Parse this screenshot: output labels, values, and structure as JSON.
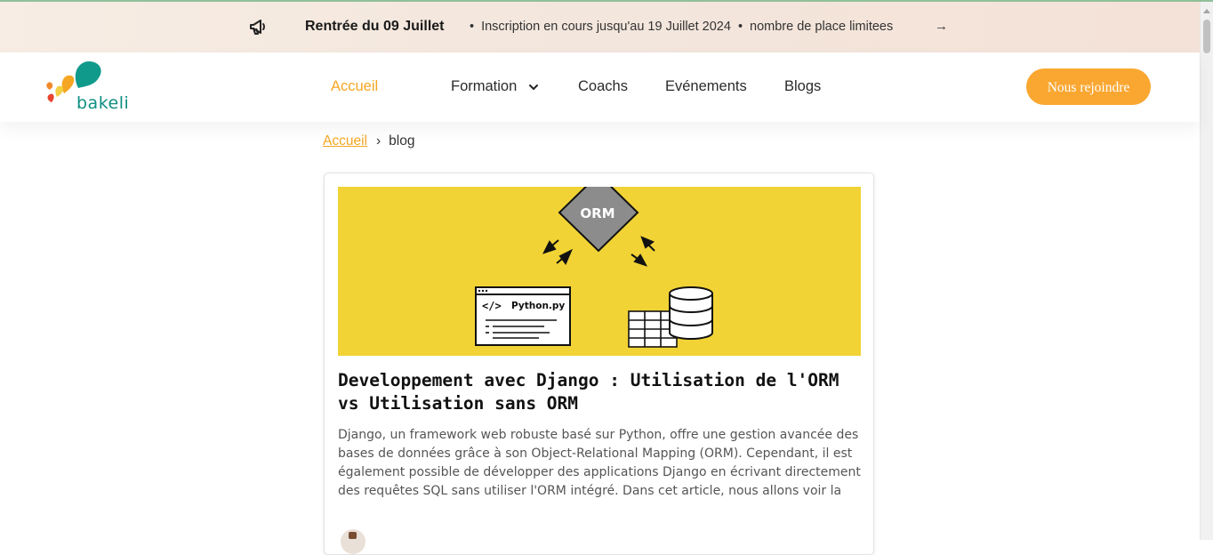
{
  "announcement": {
    "icon": "megaphone-icon",
    "headline": "Rentrée du 09 Juillet",
    "bullet": "•",
    "info_1": "Inscription en cours jusqu'au 19 Juillet 2024",
    "info_2": "nombre de place limitees",
    "arrow": "→"
  },
  "brand": {
    "name": "bakeli",
    "colors": {
      "orange": "#f5a623",
      "teal": "#0f8e82",
      "red": "#e8442f"
    }
  },
  "nav": {
    "items": [
      {
        "label": "Accueil",
        "active": true
      },
      {
        "label": "Formation",
        "has_dropdown": true
      },
      {
        "label": "Coachs"
      },
      {
        "label": "Evénements"
      },
      {
        "label": "Blogs"
      }
    ],
    "cta": "Nous rejoindre"
  },
  "breadcrumb": {
    "home": "Accueil",
    "separator": "›",
    "current": "blog"
  },
  "post": {
    "image": {
      "orm_label": "ORM",
      "file_label": "Python.py",
      "code_glyph": "</>"
    },
    "title": "Developpement avec Django : Utilisation de l'ORM vs Utilisation sans ORM",
    "excerpt": "Django, un framework web robuste basé sur Python, offre une gestion avancée des bases de données grâce à son Object-Relational Mapping (ORM). Cependant, il est également possible de développer des applications Django en écrivant directement des requêtes SQL sans utiliser l'ORM intégré. Dans cet article, nous allons voir la"
  },
  "theme": {
    "accent": "#f9a731",
    "hero_bg": "#f2d335",
    "orm_box": "#8c8c8c"
  }
}
